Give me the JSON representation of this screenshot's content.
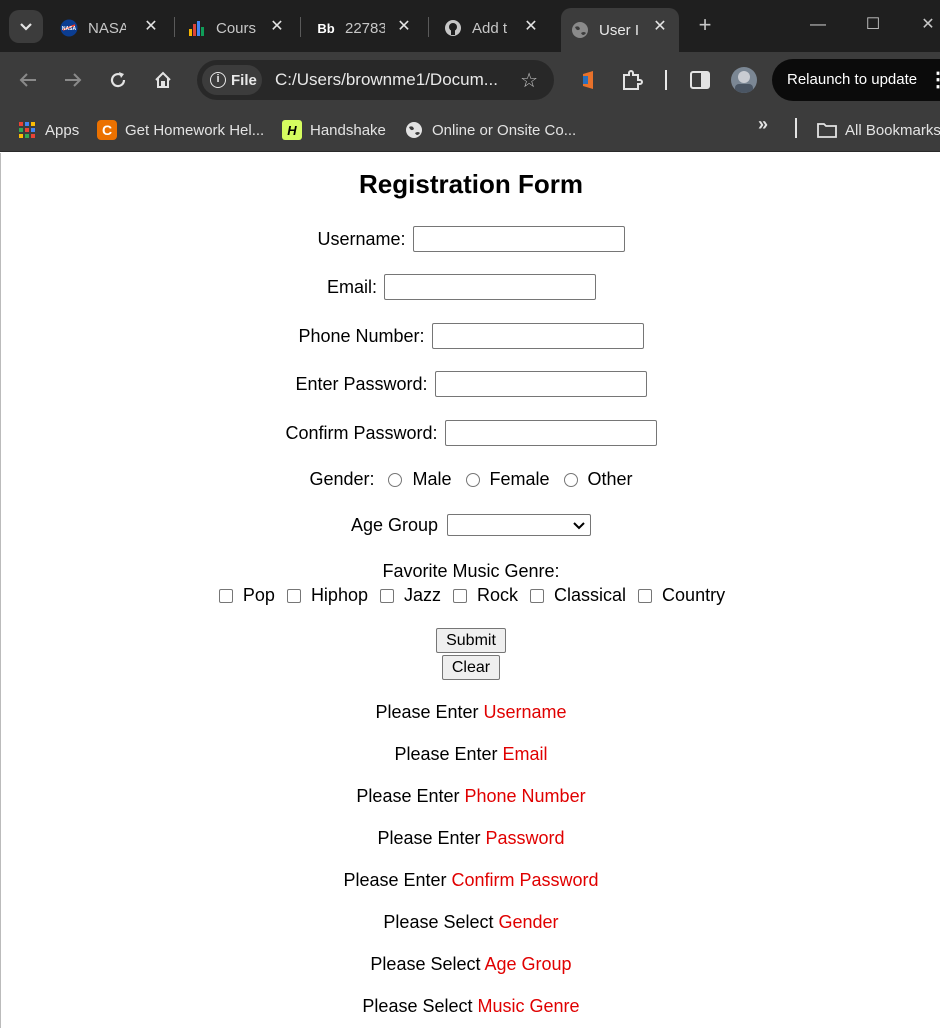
{
  "browser": {
    "tabs": [
      {
        "title": "NASA",
        "icon": "nasa-icon"
      },
      {
        "title": "Cours",
        "icon": "bar-chart-icon"
      },
      {
        "title": "22783",
        "icon": "blackboard-icon"
      },
      {
        "title": "Add t",
        "icon": "github-icon"
      },
      {
        "title": "User I",
        "icon": "globe-icon",
        "active": true
      }
    ],
    "file_chip": "File",
    "url": "C:/Users/brownme1/Docum...",
    "relaunch_label": "Relaunch to update",
    "bookmarks": [
      {
        "label": "Apps",
        "icon": "apps-grid-icon"
      },
      {
        "label": "Get Homework Hel...",
        "icon": "chegg-icon",
        "icon_text": "C"
      },
      {
        "label": "Handshake",
        "icon": "handshake-icon",
        "icon_text": "H"
      },
      {
        "label": "Online or Onsite Co...",
        "icon": "globe-icon"
      }
    ],
    "all_bookmarks": "All Bookmarks",
    "colors": {
      "tabstrip": "#1f1f1f",
      "toolbar": "#3c3c3c",
      "accent_red": "#e00000"
    }
  },
  "form": {
    "title": "Registration Form",
    "username_label": "Username:",
    "email_label": "Email:",
    "phone_label": "Phone Number:",
    "password_label": "Enter Password:",
    "confirm_label": "Confirm Password:",
    "gender_label": "Gender:",
    "gender_options": [
      "Male",
      "Female",
      "Other"
    ],
    "age_label": "Age Group",
    "age_value": "",
    "genre_label": "Favorite Music Genre:",
    "genre_options": [
      "Pop",
      "Hiphop",
      "Jazz",
      "Rock",
      "Classical",
      "Country"
    ],
    "submit_label": "Submit",
    "clear_label": "Clear"
  },
  "messages": [
    {
      "prefix": "Please Enter",
      "field": "Username"
    },
    {
      "prefix": "Please Enter",
      "field": "Email"
    },
    {
      "prefix": "Please Enter",
      "field": "Phone Number"
    },
    {
      "prefix": "Please Enter",
      "field": "Password"
    },
    {
      "prefix": "Please Enter",
      "field": "Confirm Password"
    },
    {
      "prefix": "Please Select",
      "field": "Gender"
    },
    {
      "prefix": "Please Select",
      "field": "Age Group"
    },
    {
      "prefix": "Please Select",
      "field": "Music Genre"
    }
  ]
}
